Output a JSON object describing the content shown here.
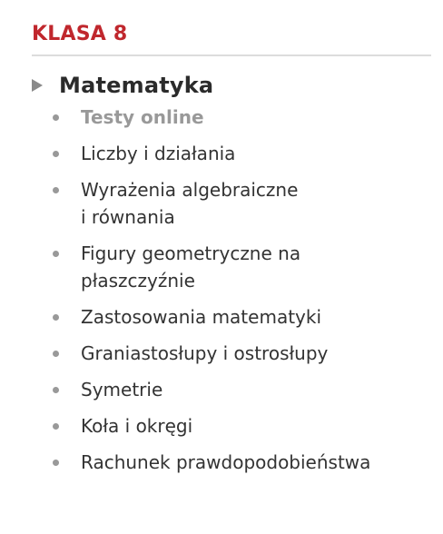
{
  "heading": "KLASA 8",
  "subject": {
    "icon": "triangle-right-icon",
    "title": "Matematyka"
  },
  "topics": [
    {
      "label": "Testy online",
      "active": true
    },
    {
      "label": "Liczby i działania"
    },
    {
      "label": "Wyrażenia algebraiczne\ni równania"
    },
    {
      "label": "Figury geometryczne na\npłaszczyźnie"
    },
    {
      "label": "Zastosowania matematyki"
    },
    {
      "label": "Graniastosłupy i ostrosłupy"
    },
    {
      "label": "Symetrie"
    },
    {
      "label": "Koła i okręgi"
    },
    {
      "label": "Rachunek prawdopodobieństwa"
    }
  ],
  "colors": {
    "heading": "#c0272d",
    "subject": "#2b2b2b",
    "topic": "#333333",
    "active_topic": "#999999",
    "bullet": "#999999",
    "divider": "#dcdcdc"
  }
}
